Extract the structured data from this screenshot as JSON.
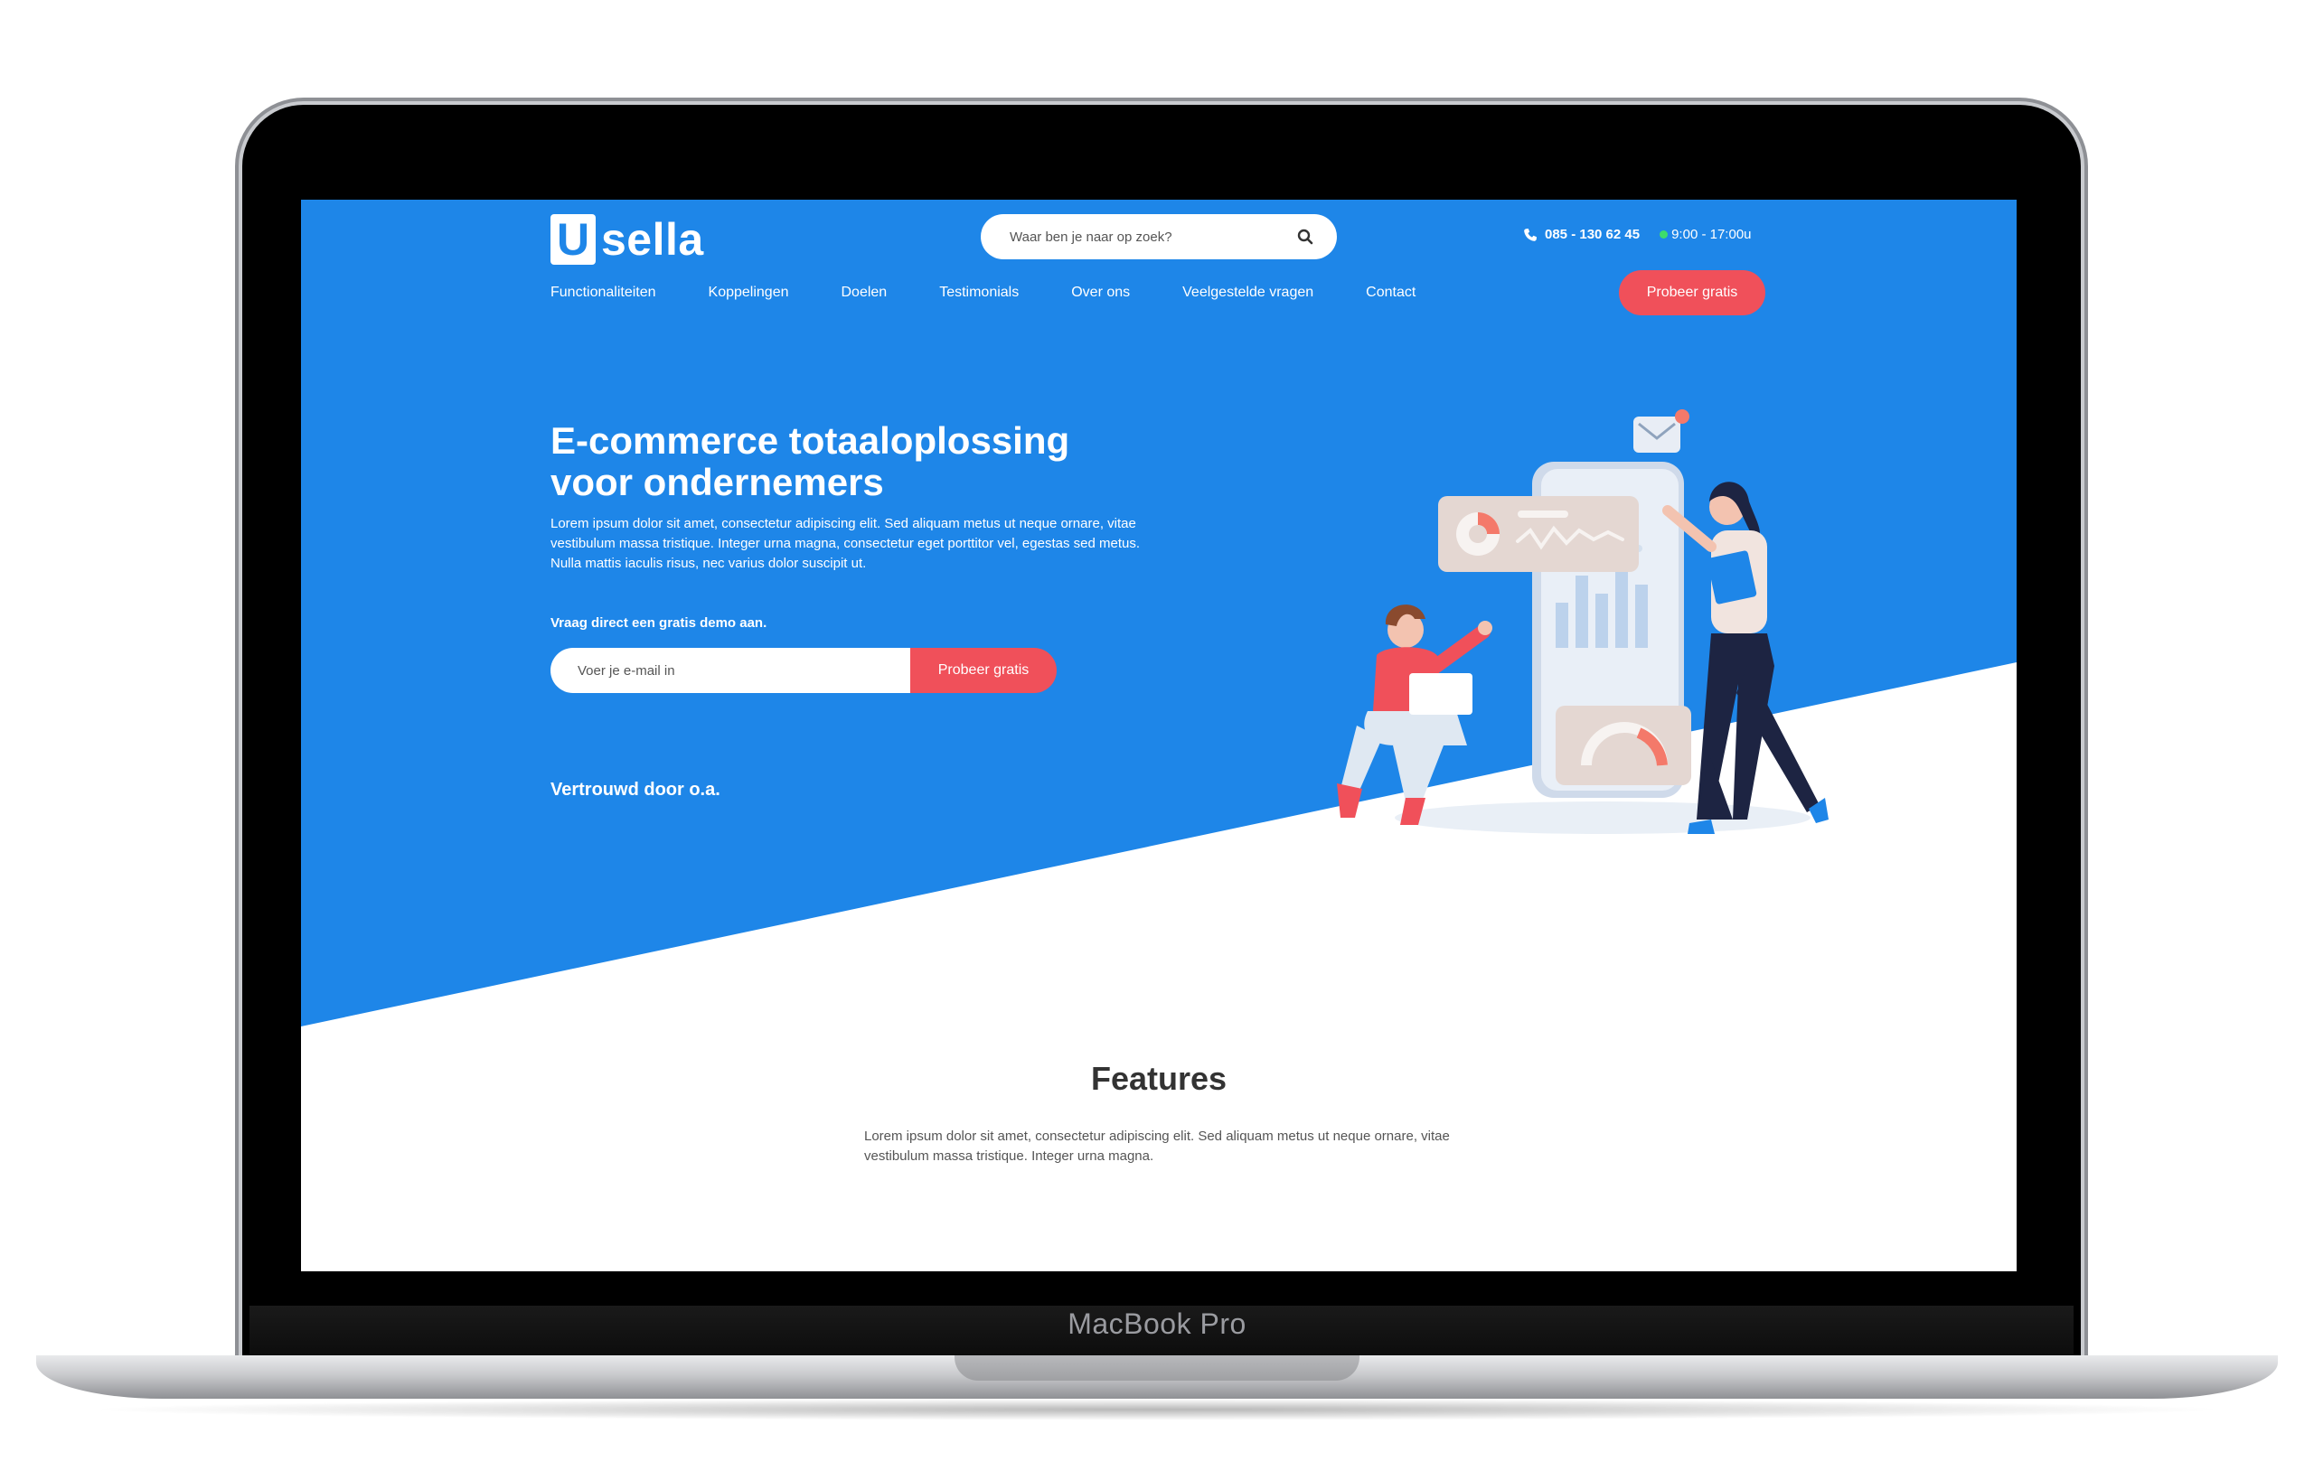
{
  "device": {
    "label": "MacBook Pro"
  },
  "header": {
    "logo_mark": "U",
    "logo_text": "sella",
    "search_placeholder": "Waar ben je naar op zoek?",
    "phone": "085 - 130 62 45",
    "hours": "9:00 - 17:00u",
    "cta_label": "Probeer gratis"
  },
  "nav": {
    "items": [
      "Functionaliteiten",
      "Koppelingen",
      "Doelen",
      "Testimonials",
      "Over ons",
      "Veelgestelde vragen",
      "Contact"
    ]
  },
  "hero": {
    "title": "E-commerce totaaloplossing voor ondernemers",
    "description": "Lorem ipsum dolor sit amet, consectetur adipiscing elit. Sed aliquam metus ut neque ornare, vitae vestibulum massa tristique. Integer urna magna, consectetur eget porttitor vel, egestas sed metus. Nulla mattis iaculis risus, nec varius dolor suscipit ut.",
    "demo_label": "Vraag direct een gratis demo aan.",
    "email_placeholder": "Voer je e-mail in",
    "signup_button": "Probeer gratis",
    "trusted_label": "Vertrouwd door o.a."
  },
  "features": {
    "title": "Features",
    "description": "Lorem ipsum dolor sit amet, consectetur adipiscing elit. Sed aliquam metus ut neque ornare, vitae vestibulum massa tristique. Integer urna magna."
  },
  "colors": {
    "primary": "#1e86e8",
    "accent": "#f0505a",
    "status_online": "#3ddc6b"
  },
  "icons": {
    "search": "search-icon",
    "phone": "phone-icon"
  }
}
